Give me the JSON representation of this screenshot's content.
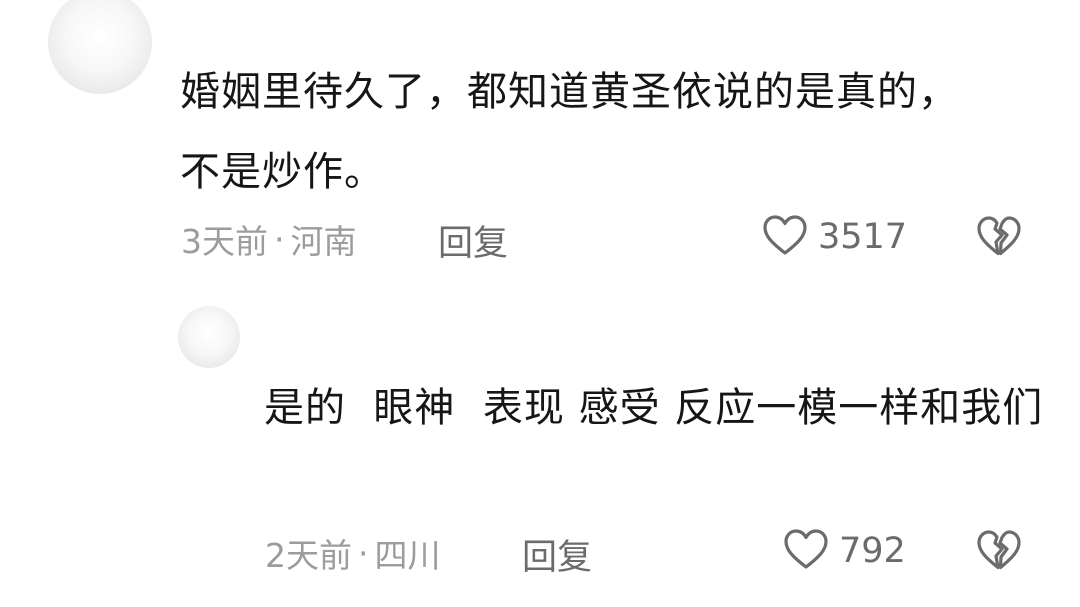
{
  "comments": [
    {
      "text": "婚姻里待久了，都知道黄圣依说的是真的，不是炒作。",
      "time": "3天前",
      "separator": "·",
      "location": "河南",
      "reply_label": "回复",
      "likes": "3517",
      "icons": {
        "like": "heart-outline-icon",
        "dislike": "broken-heart-icon"
      }
    },
    {
      "text": "是的  眼神  表现 感受 反应一模一样和我们",
      "time": "2天前",
      "separator": "·",
      "location": "四川",
      "reply_label": "回复",
      "likes": "792",
      "icons": {
        "like": "heart-outline-icon",
        "dislike": "broken-heart-icon"
      }
    }
  ],
  "colors": {
    "text": "#161616",
    "meta": "#9c9c9c",
    "action": "#6b6b6b"
  }
}
